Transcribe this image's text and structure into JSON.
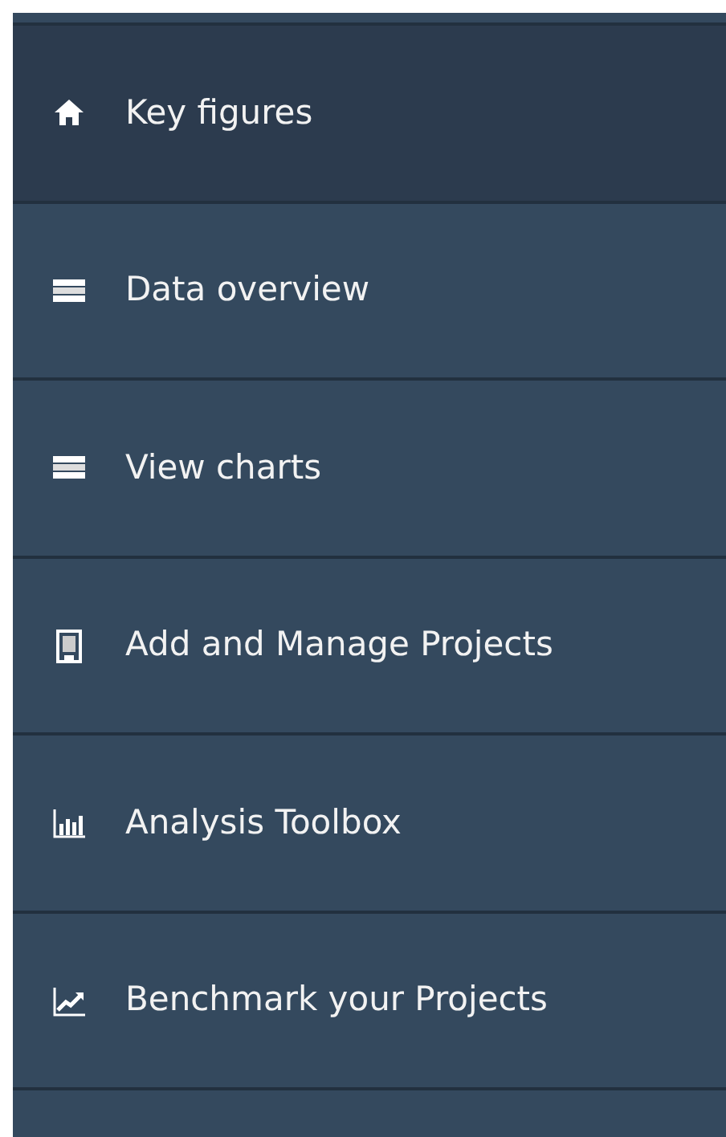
{
  "menu": {
    "items": [
      {
        "label": "Key figures",
        "selected": true
      },
      {
        "label": "Data overview",
        "selected": false
      },
      {
        "label": "View charts",
        "selected": false
      },
      {
        "label": "Add and Manage Projects",
        "selected": false
      },
      {
        "label": "Analysis Toolbox",
        "selected": false
      },
      {
        "label": "Benchmark your Projects",
        "selected": false
      }
    ]
  }
}
